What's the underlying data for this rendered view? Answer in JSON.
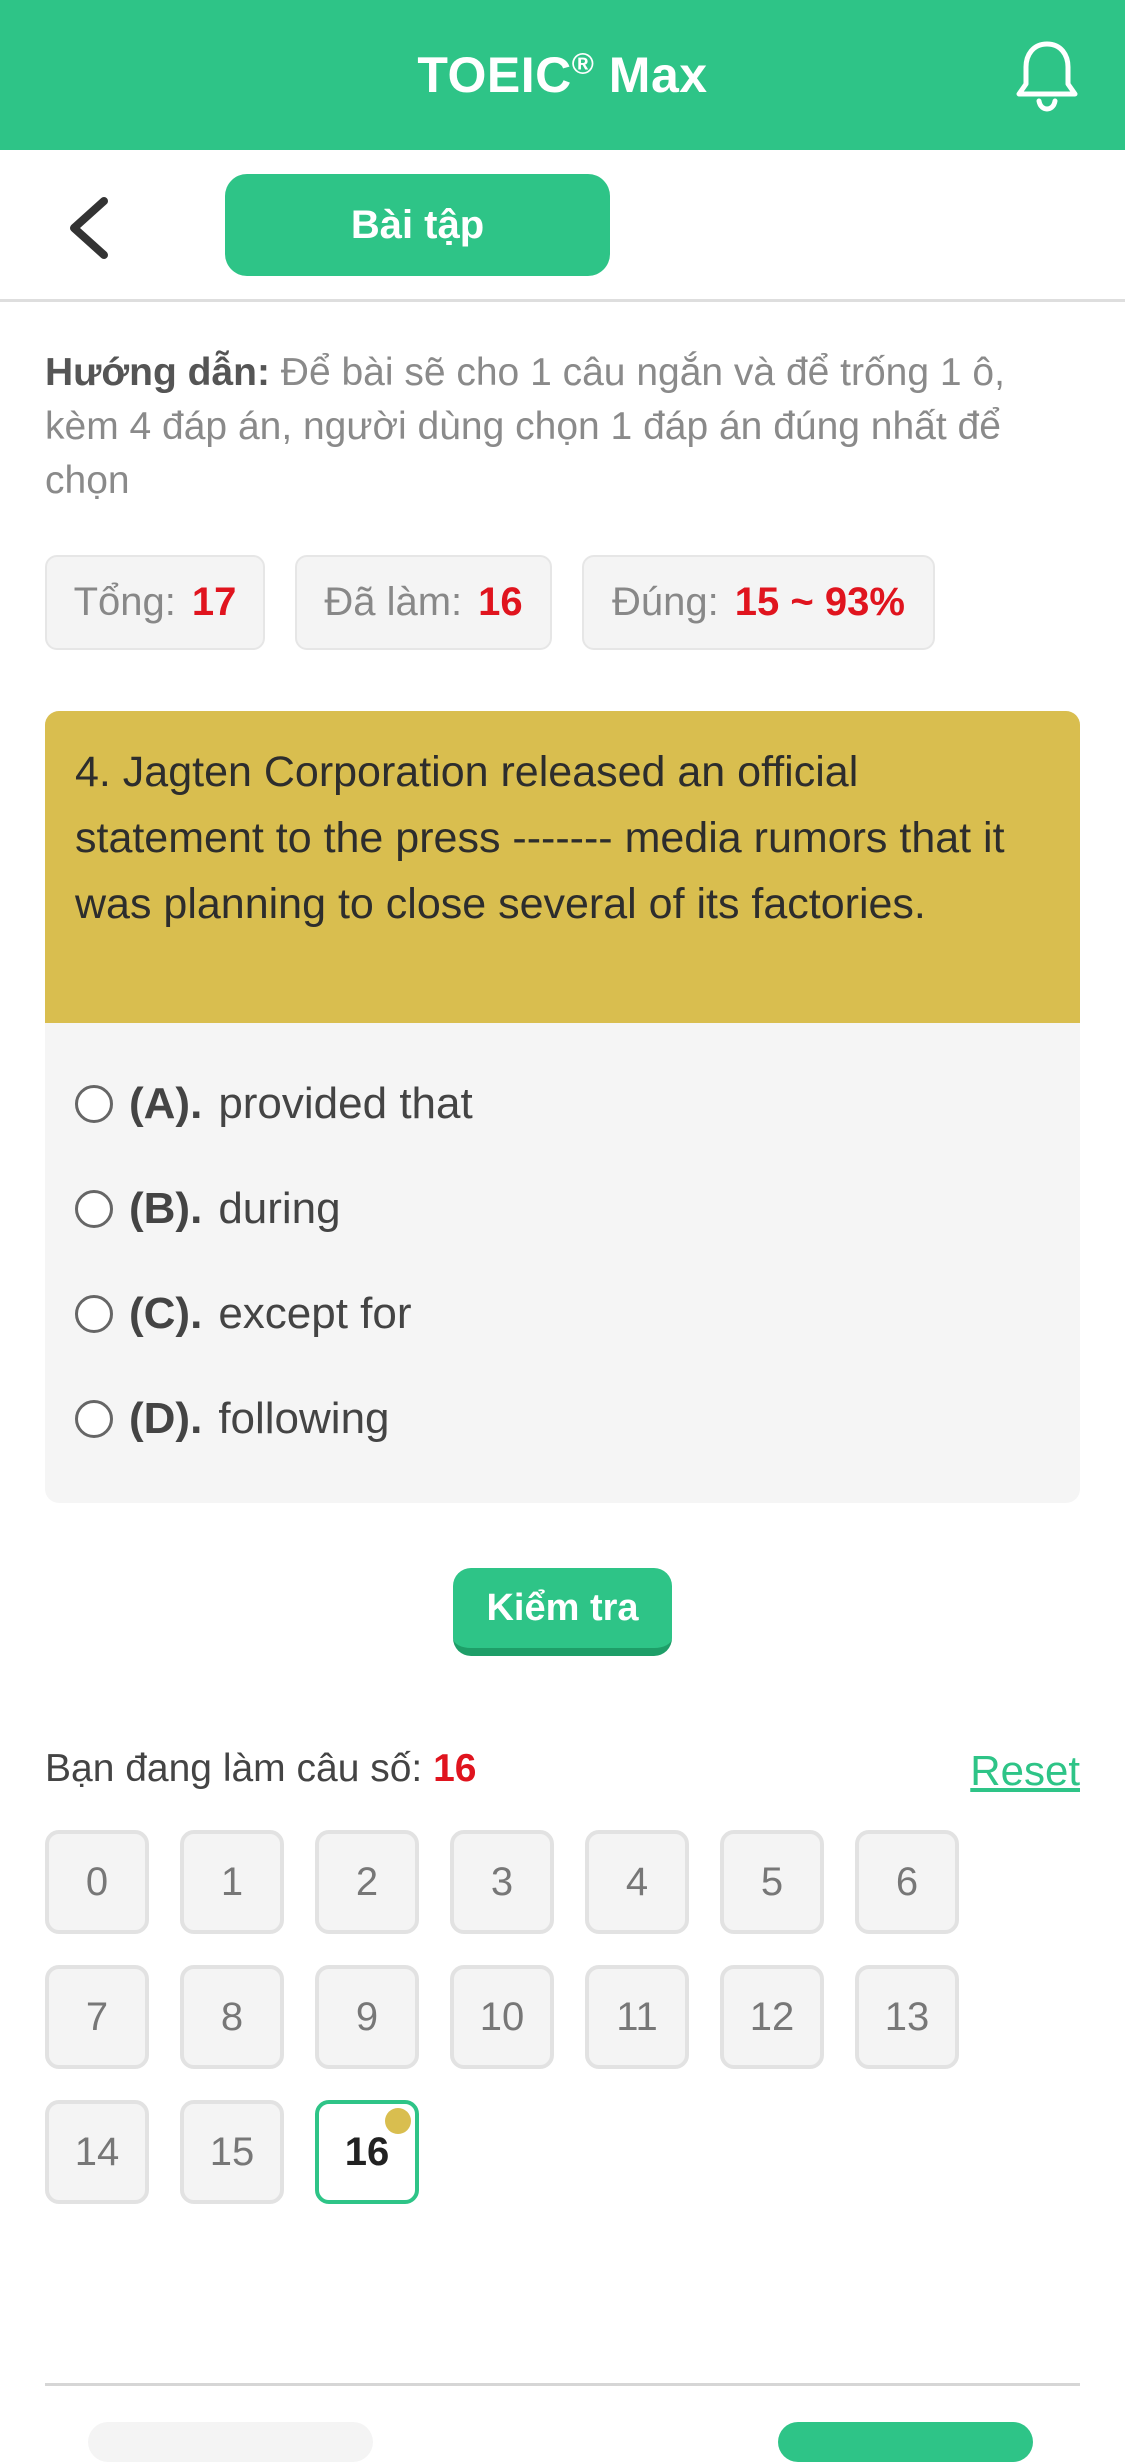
{
  "header": {
    "title": "TOEIC",
    "reg_mark": "®",
    "title_suffix": " Max"
  },
  "subbar": {
    "tab_label": "Bài tập"
  },
  "instructions": {
    "label": "Hướng dẫn:",
    "text": " Để bài sẽ cho 1 câu ngắn và để trống 1 ô, kèm 4 đáp án, người dùng chọn 1 đáp án đúng nhất để chọn"
  },
  "stats": {
    "total_label": "Tổng:",
    "total_value": "17",
    "done_label": "Đã làm:",
    "done_value": "16",
    "correct_label": "Đúng:",
    "correct_value": "15 ~ 93%"
  },
  "question": {
    "text": "4. Jagten Corporation released an official statement to the press ------- media rumors that it was planning to close several of its factories.",
    "options": [
      {
        "letter": "(A).",
        "text": "provided that"
      },
      {
        "letter": "(B).",
        "text": "during"
      },
      {
        "letter": "(C).",
        "text": "except for"
      },
      {
        "letter": "(D).",
        "text": "following"
      }
    ]
  },
  "check_button": "Kiểm tra",
  "progress": {
    "label": "Bạn đang làm câu số: ",
    "current": "16",
    "reset_label": "Reset"
  },
  "question_numbers": [
    "0",
    "1",
    "2",
    "3",
    "4",
    "5",
    "6",
    "7",
    "8",
    "9",
    "10",
    "11",
    "12",
    "13",
    "14",
    "15",
    "16"
  ],
  "colors": {
    "primary": "#2ec487",
    "question_bg": "#d9be4f",
    "accent_red": "#e0141e"
  }
}
